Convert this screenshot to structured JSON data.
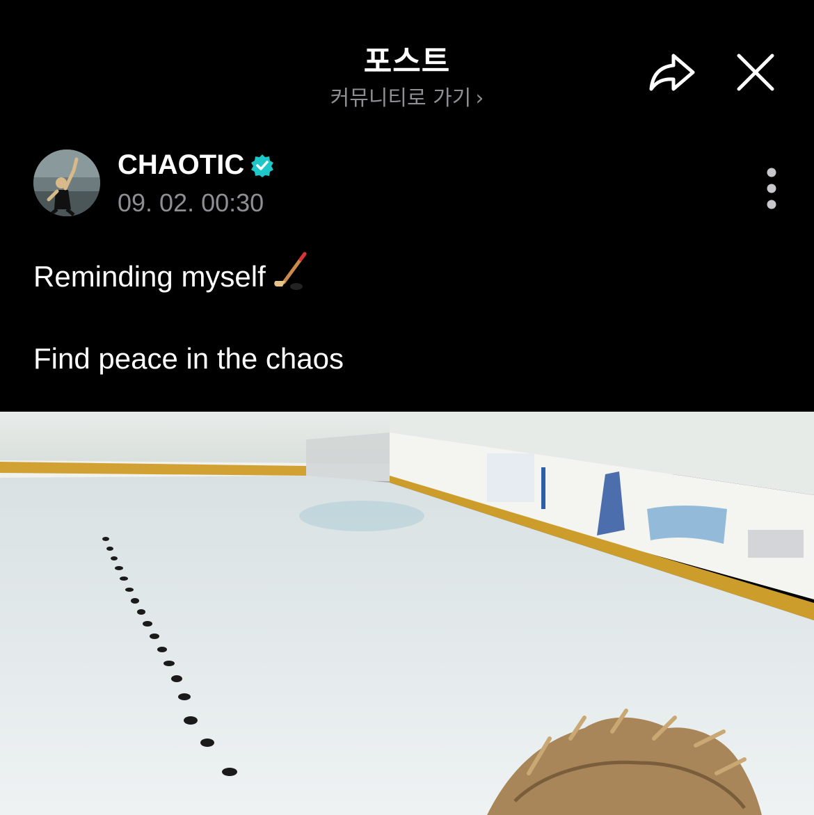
{
  "header": {
    "title": "포스트",
    "community_link": "커뮤니티로 가기",
    "chevron": "›",
    "share_icon": "share-arrow-icon",
    "close_icon": "close-icon"
  },
  "author": {
    "name": "CHAOTIC",
    "verified": true,
    "timestamp": "09. 02. 00:30",
    "more_icon": "more-vertical-icon"
  },
  "post": {
    "line1": "Reminding myself",
    "line1_emoji": "hockey-stick-icon",
    "line2": "Find peace in the chaos"
  },
  "colors": {
    "background": "#000000",
    "text": "#ffffff",
    "secondary_text": "#8e8e93",
    "verified_badge": "#1ec8c8"
  }
}
